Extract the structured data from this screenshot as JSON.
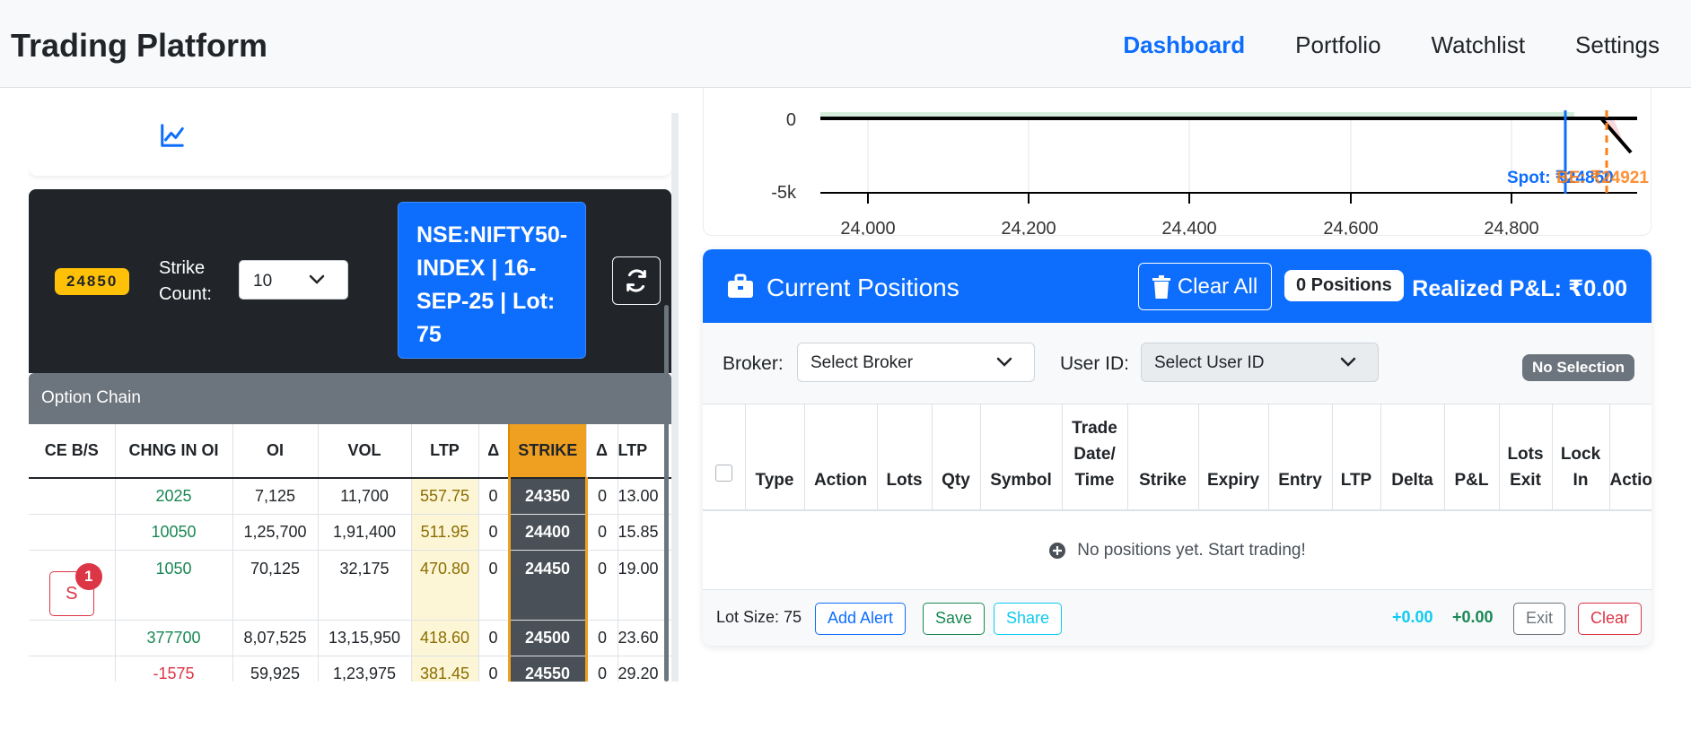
{
  "nav": {
    "brand": "Trading Platform",
    "links": [
      "Dashboard",
      "Portfolio",
      "Watchlist",
      "Settings"
    ]
  },
  "controls": {
    "spot_badge": "24850",
    "strike_count_label": "Strike Count:",
    "strike_count_value": "10",
    "index_info": "NSE:NIFTY50-INDEX | 16-SEP-25 | Lot: 75"
  },
  "option_chain": {
    "title": "Option Chain",
    "columns": [
      "CE B/S",
      "CHNG IN OI",
      "OI",
      "VOL",
      "LTP",
      "Δ",
      "STRIKE",
      "Δ",
      "LTP"
    ],
    "rows": [
      {
        "bs": "",
        "chng_oi": "2025",
        "oi": "7,125",
        "vol": "11,700",
        "ltp": "557.75",
        "delta": "0",
        "strike": "24350",
        "delta_pe": "0",
        "ltp_pe": "13.00"
      },
      {
        "bs": "",
        "chng_oi": "10050",
        "oi": "1,25,700",
        "vol": "1,91,400",
        "ltp": "511.95",
        "delta": "0",
        "strike": "24400",
        "delta_pe": "0",
        "ltp_pe": "15.85"
      },
      {
        "bs": "S",
        "bs_count": "1",
        "chng_oi": "1050",
        "oi": "70,125",
        "vol": "32,175",
        "ltp": "470.80",
        "delta": "0",
        "strike": "24450",
        "delta_pe": "0",
        "ltp_pe": "19.00"
      },
      {
        "bs": "",
        "chng_oi": "377700",
        "oi": "8,07,525",
        "vol": "13,15,950",
        "ltp": "418.60",
        "delta": "0",
        "strike": "24500",
        "delta_pe": "0",
        "ltp_pe": "23.60"
      },
      {
        "bs": "",
        "chng_oi": "-1575",
        "oi": "59,925",
        "vol": "1,23,975",
        "ltp": "381.45",
        "delta": "0",
        "strike": "24550",
        "delta_pe": "0",
        "ltp_pe": "29.20"
      }
    ]
  },
  "payoff_chart": {
    "y_ticks": [
      "0",
      "-5k"
    ],
    "x_ticks": [
      "24,000",
      "24,200",
      "24,400",
      "24,600",
      "24,800"
    ],
    "spot_label": "Spot: ₹24850",
    "be_label": "BE: ₹24921"
  },
  "positions": {
    "title": "Current Positions",
    "clear_all": "Clear All",
    "count": "0 Positions",
    "realized": "Realized P&L: ₹0.00",
    "broker_label": "Broker:",
    "broker_placeholder": "Select Broker",
    "user_label": "User ID:",
    "user_placeholder": "Select User ID",
    "selection_badge": "No Selection",
    "columns": [
      "Type",
      "Action",
      "Lots",
      "Qty",
      "Symbol",
      "Trade Date/ Time",
      "Strike",
      "Expiry",
      "Entry",
      "LTP",
      "Delta",
      "P&L",
      "Lots Exit",
      "Lock In",
      "Actions"
    ],
    "empty_message": "No positions yet. Start trading!",
    "lot_size": "Lot Size: 75",
    "buttons": {
      "add_alert": "Add Alert",
      "save": "Save",
      "share": "Share",
      "exit": "Exit",
      "clear": "Clear"
    },
    "totals": {
      "first": "+0.00",
      "second": "+0.00"
    }
  },
  "colors": {
    "primary": "#0d6efd",
    "dark": "#212529",
    "strike": "#f0a020",
    "badge": "#ffc107",
    "danger": "#dc3545",
    "success": "#198754"
  }
}
